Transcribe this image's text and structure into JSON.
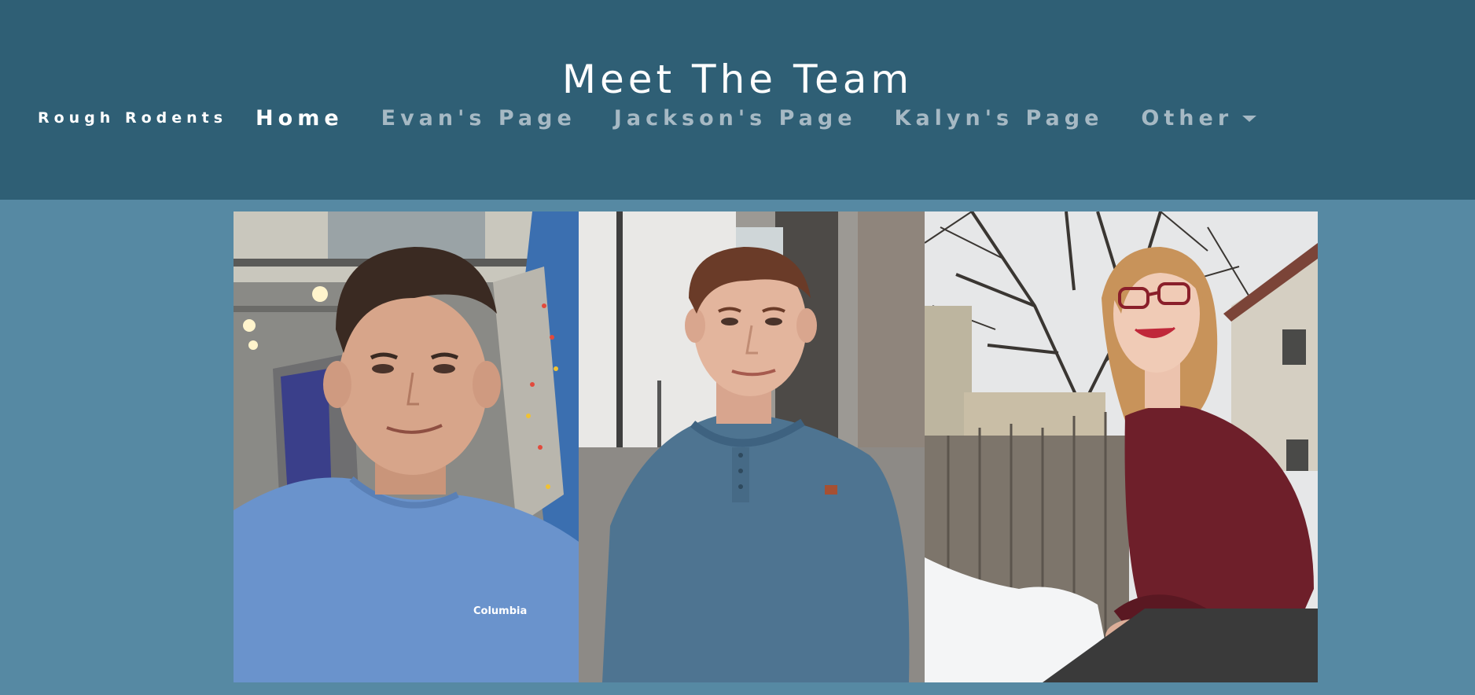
{
  "header": {
    "title": "Meet The Team"
  },
  "nav": {
    "brand": "Rough Rodents",
    "links": [
      {
        "label": "Home",
        "active": true
      },
      {
        "label": "Evan's Page",
        "active": false
      },
      {
        "label": "Jackson's Page",
        "active": false
      },
      {
        "label": "Kalyn's Page",
        "active": false
      }
    ],
    "dropdown": {
      "label": "Other",
      "icon": "caret-down-icon"
    }
  },
  "gallery": {
    "photos": [
      {
        "name": "photo-evan",
        "shirt_text": "Columbia"
      },
      {
        "name": "photo-jackson"
      },
      {
        "name": "photo-kalyn"
      }
    ]
  },
  "colors": {
    "header_bg": "#2f5f75",
    "page_bg": "#5689a3",
    "nav_active": "#ffffff",
    "nav_inactive": "#a6b9c4"
  }
}
